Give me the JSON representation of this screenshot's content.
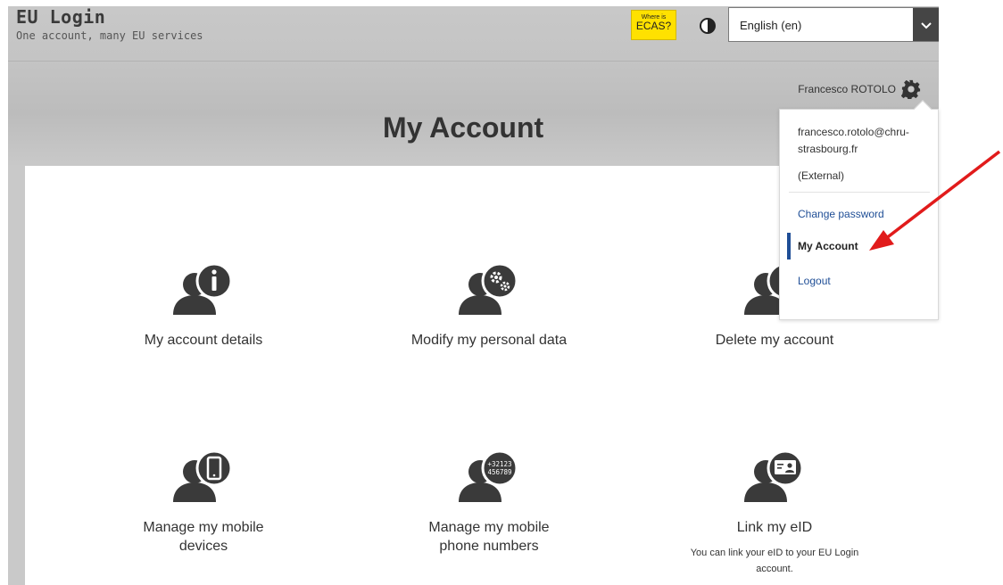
{
  "header": {
    "title": "EU Login",
    "tagline": "One account, many EU services",
    "ecas_small": "Where is",
    "ecas_big": "ECAS?",
    "language": "English (en)"
  },
  "user": {
    "name": "Francesco ROTOLO"
  },
  "page": {
    "title": "My Account"
  },
  "tiles": [
    {
      "label": "My account details",
      "icon": "user-info-icon"
    },
    {
      "label": "Modify my personal data",
      "icon": "user-gears-icon"
    },
    {
      "label": "Delete my account",
      "icon": "user-delete-icon"
    },
    {
      "label": "Manage my mobile devices",
      "icon": "user-mobile-icon"
    },
    {
      "label": "Manage my mobile phone numbers",
      "icon": "user-phone-number-icon",
      "badge": [
        "+32123",
        "456789"
      ]
    },
    {
      "label": "Link my eID",
      "desc": "You can link your eID to your EU Login account.",
      "icon": "user-eid-card-icon"
    }
  ],
  "dropdown": {
    "email": "francesco.rotolo@chru-strasbourg.fr",
    "account_type": "(External)",
    "change_password": "Change password",
    "my_account": "My Account",
    "logout": "Logout"
  },
  "colors": {
    "ecas_badge": "#ffe100",
    "link": "#1f4e96",
    "annotation_arrow": "#e11b1b",
    "icon": "#3a3a3a"
  }
}
